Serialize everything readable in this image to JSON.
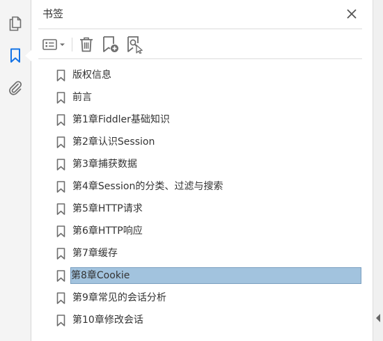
{
  "panel": {
    "title": "书签"
  },
  "rail": {
    "items": [
      {
        "icon": "pages-icon",
        "active": false
      },
      {
        "icon": "bookmark-icon",
        "active": true
      },
      {
        "icon": "paperclip-icon",
        "active": false
      }
    ]
  },
  "toolbar": {
    "buttons": [
      "options-menu-icon",
      "trash-icon",
      "add-bookmark-icon",
      "find-bookmark-icon"
    ]
  },
  "bookmarks": [
    {
      "label": "版权信息",
      "selected": false
    },
    {
      "label": "前言",
      "selected": false
    },
    {
      "label": "第1章Fiddler基础知识",
      "selected": false
    },
    {
      "label": "第2章认识Session",
      "selected": false
    },
    {
      "label": "第3章捕获数据",
      "selected": false
    },
    {
      "label": "第4章Session的分类、过滤与搜索",
      "selected": false
    },
    {
      "label": "第5章HTTP请求",
      "selected": false
    },
    {
      "label": "第6章HTTP响应",
      "selected": false
    },
    {
      "label": "第7章缓存",
      "selected": false
    },
    {
      "label": "第8章Cookie",
      "selected": true
    },
    {
      "label": "第9章常见的会话分析",
      "selected": false
    },
    {
      "label": "第10章修改会话",
      "selected": false
    }
  ],
  "colors": {
    "selection": "#a2c3de",
    "accent": "#1473e6",
    "icon": "#6e6e6e"
  }
}
